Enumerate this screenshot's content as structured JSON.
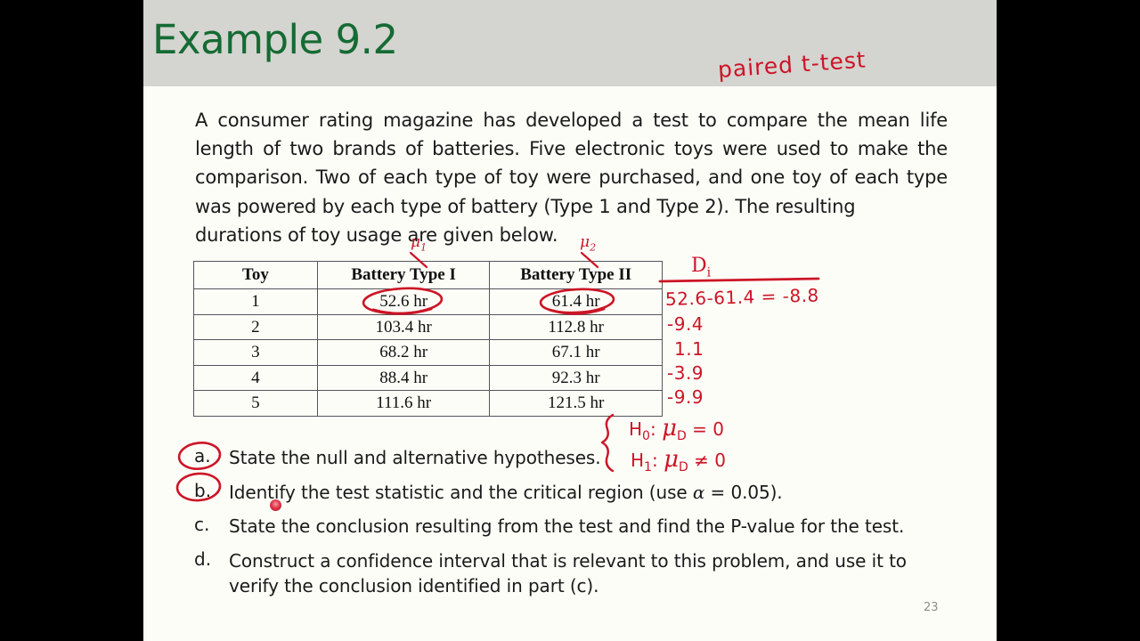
{
  "slide": {
    "title": "Example 9.2",
    "page_number": "23",
    "title_color": "#156b33",
    "header_color": "#d4d4d0",
    "ink_color": "#cc1526",
    "body_text": "A consumer rating magazine has developed a test to compare the mean life length of two brands of batteries. Five electronic toys were used to make the comparison. Two of each type of toy were purchased, and one toy of each type was powered by each type of battery (Type 1 and Type 2). The resulting",
    "body_text_lastline": "durations of toy usage are given below."
  },
  "table": {
    "headers": [
      "Toy",
      "Battery Type I",
      "Battery Type II"
    ],
    "rows": [
      [
        "1",
        "52.6 hr",
        "61.4 hr"
      ],
      [
        "2",
        "103.4 hr",
        "112.8 hr"
      ],
      [
        "3",
        "68.2 hr",
        "67.1 hr"
      ],
      [
        "4",
        "88.4 hr",
        "92.3 hr"
      ],
      [
        "5",
        "111.6 hr",
        "121.5 hr"
      ]
    ]
  },
  "questions": [
    {
      "mark": "a.",
      "text": "State the null and alternative hypotheses.",
      "cont": ""
    },
    {
      "mark": "b.",
      "text_pre": "Identify the test statistic and the critical region (use ",
      "alpha": "α",
      "text_post": " = 0.05).",
      "cont": ""
    },
    {
      "mark": "c.",
      "text": "State the conclusion resulting from the test and find the P-value for the test.",
      "cont": ""
    },
    {
      "mark": "d.",
      "text": "Construct a confidence interval that is relevant to this problem, and use it to",
      "cont": "verify the conclusion identified in part (c)."
    }
  ],
  "annotations": {
    "paired_ttest": "paired t-test",
    "mu1": "μ",
    "mu1_sub": "1",
    "mu2": "μ",
    "mu2_sub": "2",
    "di_label": "D",
    "di_sub": "i",
    "differences": [
      "52.6-61.4 = -8.8",
      "-9.4",
      "1.1",
      "-3.9",
      "-9.9"
    ],
    "h0_label": "H",
    "h0_sub": "0",
    "h0_colon": ":",
    "h0_mu": "μ",
    "h0_musub": "D",
    "h0_rel": "= 0",
    "h1_label": "H",
    "h1_sub": "1",
    "h1_colon": ":",
    "h1_mu": "μ",
    "h1_musub": "D",
    "h1_rel": "≠ 0"
  }
}
